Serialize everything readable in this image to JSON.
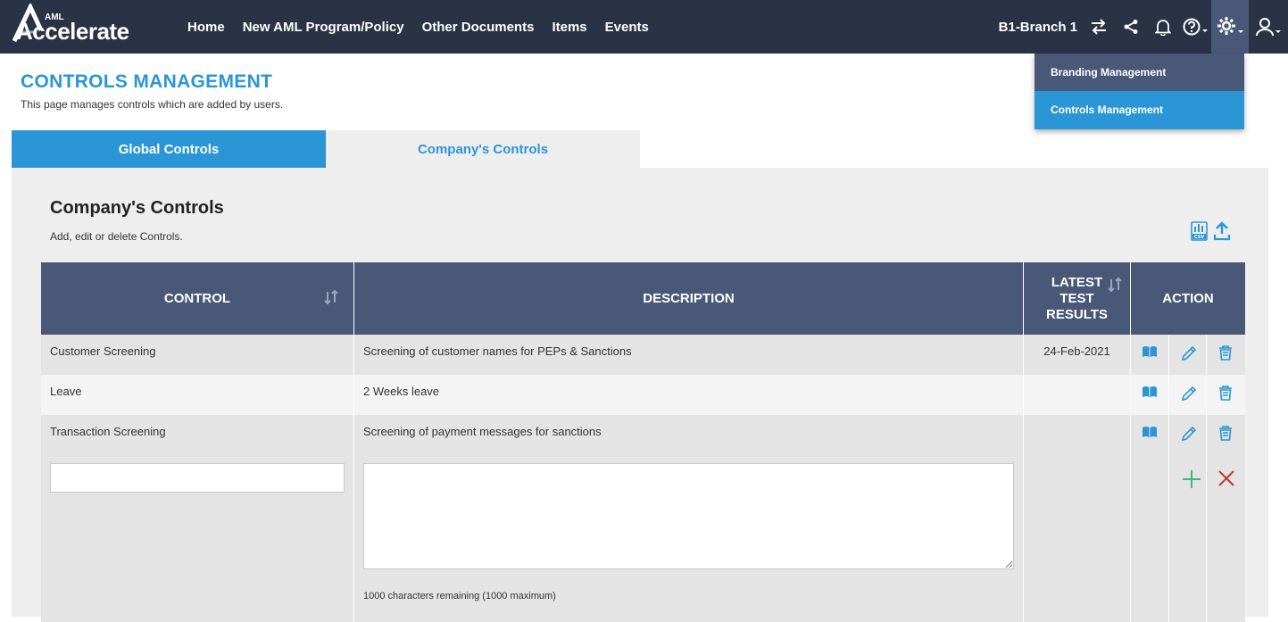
{
  "brand": {
    "small": "AML",
    "name": "Accelerate"
  },
  "nav": {
    "items": [
      "Home",
      "New AML Program/Policy",
      "Other Documents",
      "Items",
      "Events"
    ],
    "branch": "B1-Branch 1"
  },
  "dropdown": {
    "items": [
      "Branding Management",
      "Controls Management"
    ]
  },
  "page": {
    "title": "CONTROLS MANAGEMENT",
    "subtitle": "This page manages controls which are added by users."
  },
  "tabs": {
    "global": "Global Controls",
    "company": "Company's Controls"
  },
  "panel": {
    "title": "Company's Controls",
    "subtitle": "Add, edit or delete Controls."
  },
  "table": {
    "headers": {
      "control": "CONTROL",
      "description": "DESCRIPTION",
      "latest": "LATEST TEST RESULTS",
      "action": "ACTION"
    },
    "rows": [
      {
        "control": "Customer Screening",
        "description": "Screening of customer names for PEPs & Sanctions",
        "date": "24-Feb-2021"
      },
      {
        "control": "Leave",
        "description": "2 Weeks leave",
        "date": ""
      },
      {
        "control": "Transaction Screening",
        "description": "Screening of payment messages for sanctions",
        "date": ""
      }
    ],
    "new_row": {
      "control_value": "",
      "description_value": "",
      "chars_remaining": "1000 characters remaining (1000 maximum)"
    }
  },
  "colors": {
    "topbar": "#2a3345",
    "accent": "#2b96d6",
    "table_header": "#4a5878",
    "add": "#3cb878",
    "cancel": "#c0392b"
  }
}
